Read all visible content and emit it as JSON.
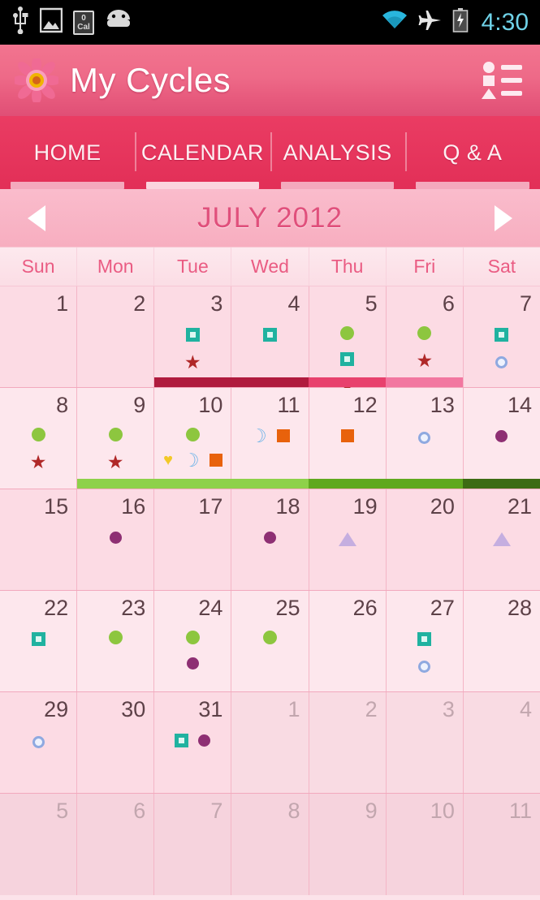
{
  "status_bar": {
    "time": "4:30",
    "left_icons": [
      "usb-icon",
      "image-icon",
      "calorie-icon",
      "android-icon"
    ],
    "calorie_value": "0",
    "calorie_unit": "Cal",
    "right_icons": [
      "wifi-icon",
      "airplane-mode-icon",
      "battery-charging-icon"
    ],
    "clock_color": "#6fd2e8"
  },
  "action_bar": {
    "title": "My Cycles",
    "logo_icon": "flower-icon",
    "menu_icon": "legend-list-icon",
    "background_color": "#ee6a88"
  },
  "tabs": [
    {
      "label": "HOME",
      "active": false
    },
    {
      "label": "CALENDAR",
      "active": true
    },
    {
      "label": "ANALYSIS",
      "active": false
    },
    {
      "label": "Q & A",
      "active": false
    }
  ],
  "month_nav": {
    "prev_icon": "chevron-left-icon",
    "next_icon": "chevron-right-icon",
    "label": "JULY 2012",
    "label_color": "#e0507c"
  },
  "weekdays": [
    "Sun",
    "Mon",
    "Tue",
    "Wed",
    "Thu",
    "Fri",
    "Sat"
  ],
  "legend_colors": {
    "period_heavy": "#b01b3e",
    "period_medium": "#e8416d",
    "period_light": "#f277a0",
    "fertile_light": "#8ed14a",
    "fertile_medium": "#5fa81e",
    "ovulation_dark": "#3d6b14",
    "intercourse_dot": "#8dc63f",
    "symptom_purple": "#8e2f73",
    "pill_teal": "#20b2a0",
    "note_orange": "#e8620c",
    "mood_star": "#b02828",
    "test_blue": "#8fa9e0",
    "triangle_violet": "#c5aee0",
    "heart_yellow": "#f2c928",
    "moon_blue": "#6fb4e8"
  },
  "weeks": [
    {
      "days": [
        {
          "num": "1",
          "month": "current",
          "markers": []
        },
        {
          "num": "2",
          "month": "current",
          "markers": []
        },
        {
          "num": "3",
          "month": "current",
          "markers": [
            "square-teal",
            "star-red"
          ]
        },
        {
          "num": "4",
          "month": "current",
          "markers": [
            "square-teal"
          ]
        },
        {
          "num": "5",
          "month": "current",
          "markers": [
            "dot-green",
            "square-teal",
            "star-red"
          ]
        },
        {
          "num": "6",
          "month": "current",
          "markers": [
            "dot-green",
            "star-red"
          ]
        },
        {
          "num": "7",
          "month": "current",
          "markers": [
            "square-teal",
            "circle-blue"
          ]
        }
      ],
      "bar": [
        null,
        null,
        "period_heavy",
        "period_heavy",
        "period_medium",
        "period_light",
        null
      ]
    },
    {
      "days": [
        {
          "num": "8",
          "month": "current",
          "markers": [
            "dot-green",
            "star-red"
          ]
        },
        {
          "num": "9",
          "month": "current",
          "markers": [
            "dot-green",
            "star-red"
          ]
        },
        {
          "num": "10",
          "month": "current",
          "markers": [
            "heart-yellow",
            "moon-blue",
            "dot-green",
            "square-orange"
          ]
        },
        {
          "num": "11",
          "month": "current",
          "markers": [
            "moon-blue",
            "square-orange"
          ]
        },
        {
          "num": "12",
          "month": "current",
          "markers": [
            "square-orange"
          ]
        },
        {
          "num": "13",
          "month": "current",
          "markers": [
            "circle-blue"
          ]
        },
        {
          "num": "14",
          "month": "current",
          "markers": [
            "dot-purple"
          ]
        }
      ],
      "bar": [
        null,
        "fertile_light",
        "fertile_light",
        "fertile_light",
        "fertile_medium",
        "fertile_medium",
        "ovulation_dark"
      ]
    },
    {
      "days": [
        {
          "num": "15",
          "month": "current",
          "markers": []
        },
        {
          "num": "16",
          "month": "current",
          "markers": [
            "dot-purple"
          ]
        },
        {
          "num": "17",
          "month": "current",
          "markers": []
        },
        {
          "num": "18",
          "month": "current",
          "markers": [
            "dot-purple"
          ]
        },
        {
          "num": "19",
          "month": "current",
          "markers": [
            "triangle-violet"
          ]
        },
        {
          "num": "20",
          "month": "current",
          "markers": []
        },
        {
          "num": "21",
          "month": "current",
          "markers": [
            "triangle-violet"
          ]
        }
      ],
      "bar": [
        null,
        null,
        null,
        null,
        null,
        null,
        null
      ]
    },
    {
      "days": [
        {
          "num": "22",
          "month": "current",
          "markers": [
            "square-teal"
          ]
        },
        {
          "num": "23",
          "month": "current",
          "markers": [
            "dot-green"
          ]
        },
        {
          "num": "24",
          "month": "current",
          "markers": [
            "dot-green",
            "dot-purple"
          ]
        },
        {
          "num": "25",
          "month": "current",
          "markers": [
            "dot-green"
          ]
        },
        {
          "num": "26",
          "month": "current",
          "markers": []
        },
        {
          "num": "27",
          "month": "current",
          "markers": [
            "square-teal",
            "circle-blue"
          ]
        },
        {
          "num": "28",
          "month": "current",
          "markers": []
        }
      ],
      "bar": [
        null,
        null,
        null,
        null,
        null,
        null,
        null
      ]
    },
    {
      "days": [
        {
          "num": "29",
          "month": "current",
          "markers": [
            "circle-blue"
          ]
        },
        {
          "num": "30",
          "month": "current",
          "markers": []
        },
        {
          "num": "31",
          "month": "current",
          "markers": [
            "square-teal",
            "dot-purple"
          ]
        },
        {
          "num": "1",
          "month": "next",
          "markers": []
        },
        {
          "num": "2",
          "month": "next",
          "markers": []
        },
        {
          "num": "3",
          "month": "next",
          "markers": []
        },
        {
          "num": "4",
          "month": "next",
          "markers": []
        }
      ],
      "bar": [
        null,
        null,
        null,
        null,
        null,
        null,
        null
      ]
    },
    {
      "days": [
        {
          "num": "5",
          "month": "next",
          "markers": []
        },
        {
          "num": "6",
          "month": "next",
          "markers": []
        },
        {
          "num": "7",
          "month": "next",
          "markers": []
        },
        {
          "num": "8",
          "month": "next",
          "markers": []
        },
        {
          "num": "9",
          "month": "next",
          "markers": []
        },
        {
          "num": "10",
          "month": "next",
          "markers": []
        },
        {
          "num": "11",
          "month": "next",
          "markers": []
        }
      ],
      "bar": [
        null,
        null,
        null,
        null,
        null,
        null,
        null
      ]
    }
  ]
}
